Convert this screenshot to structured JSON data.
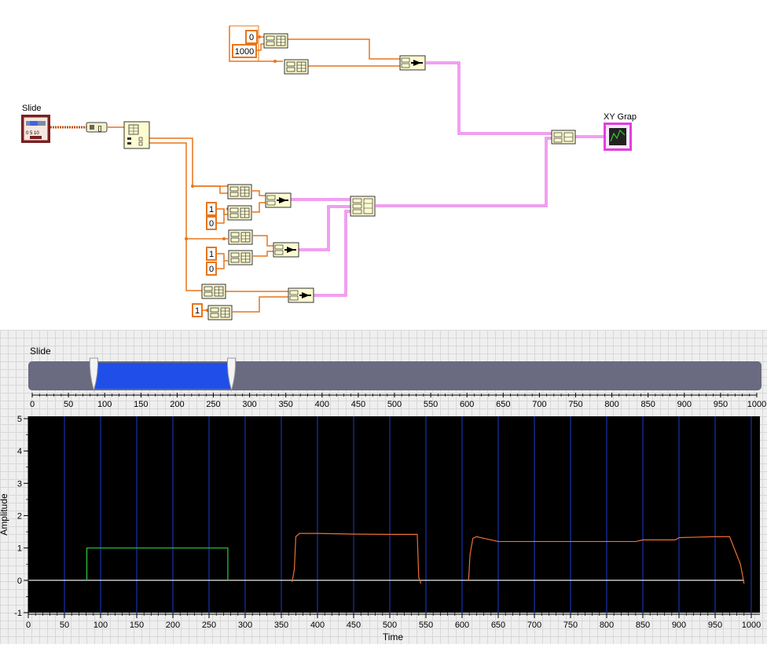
{
  "block_diagram": {
    "slide_terminal_label": "Slide",
    "xy_graph_terminal_label": "XY Grap",
    "constants": [
      "0",
      "1000",
      "1",
      "0",
      "1",
      "0",
      "1"
    ]
  },
  "front_panel": {
    "slide": {
      "label": "Slide",
      "min": 0,
      "max": 1000,
      "low_value": 85,
      "high_value": 275,
      "ticks": [
        "0",
        "50",
        "100",
        "150",
        "200",
        "250",
        "300",
        "350",
        "400",
        "450",
        "500",
        "550",
        "600",
        "650",
        "700",
        "750",
        "800",
        "850",
        "900",
        "950",
        "1000"
      ],
      "track_color": "#6a6a80",
      "fill_color": "#1f4fe8"
    }
  },
  "chart_data": {
    "type": "line",
    "xlabel": "Time",
    "ylabel": "Amplitude",
    "xlim": [
      0,
      1000
    ],
    "ylim": [
      -1,
      5
    ],
    "x_ticks": [
      "0",
      "50",
      "100",
      "150",
      "200",
      "250",
      "300",
      "350",
      "400",
      "450",
      "500",
      "550",
      "600",
      "650",
      "700",
      "750",
      "800",
      "850",
      "900",
      "950",
      "1000"
    ],
    "y_ticks": [
      "-1",
      "0",
      "1",
      "2",
      "3",
      "4",
      "5"
    ],
    "grid": "vertical",
    "background": "#000000",
    "series": [
      {
        "color": "#ffffff",
        "x": [
          0,
          990
        ],
        "y": [
          0,
          0
        ]
      },
      {
        "color": "#2ecc40",
        "x": [
          81,
          81,
          276,
          276
        ],
        "y": [
          0,
          1,
          1,
          0
        ]
      },
      {
        "color": "#f07030",
        "x": [
          365,
          368,
          370,
          375,
          400,
          450,
          500,
          538,
          540,
          543
        ],
        "y": [
          -0.05,
          0.35,
          1.35,
          1.45,
          1.45,
          1.43,
          1.42,
          1.42,
          0.1,
          -0.1
        ]
      },
      {
        "color": "#f07030",
        "x": [
          609,
          611,
          615,
          620,
          630,
          650,
          700,
          750,
          800,
          840,
          850,
          895,
          900,
          950,
          970,
          985,
          990
        ],
        "y": [
          0,
          0.8,
          1.3,
          1.35,
          1.3,
          1.2,
          1.2,
          1.2,
          1.2,
          1.2,
          1.25,
          1.25,
          1.32,
          1.35,
          1.35,
          0.5,
          -0.1
        ]
      }
    ]
  }
}
